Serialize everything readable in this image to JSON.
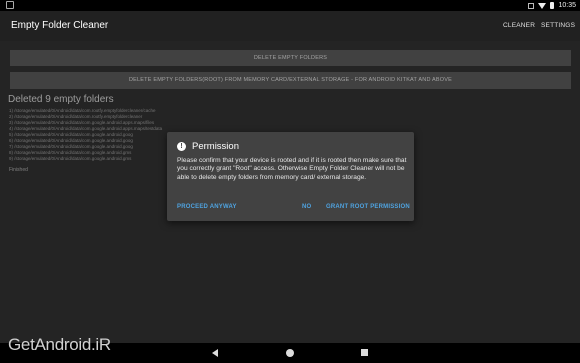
{
  "status_bar": {
    "time": "10:35"
  },
  "action_bar": {
    "title": "Empty Folder Cleaner",
    "menu": [
      "CLEANER",
      "SETTINGS"
    ]
  },
  "main": {
    "delete_button": "DELETE  EMPTY  FOLDERS",
    "delete_root_button": "DELETE EMPTY FOLDERS(ROOT) FROM MEMORY CARD/EXTERNAL STORAGE - FOR ANDROID KITKAT AND ABOVE",
    "deleted_title": "Deleted 9 empty folders",
    "folders": [
      "1) /storage/emulated/0/Android/data/com.rootfy.emptyfoldercleaner/cache",
      "2) /storage/emulated/0/Android/data/com.rootfy.emptyfoldercleaner",
      "3) /storage/emulated/0/Android/data/com.google.android.apps.maps/files",
      "4) /storage/emulated/0/Android/data/com.google.android.apps.maps/testdata",
      "5) /storage/emulated/0/Android/data/com.google.android.goog",
      "6) /storage/emulated/0/Android/data/com.google.android.goog",
      "7) /storage/emulated/0/Android/data/com.google.android.goog",
      "8) /storage/emulated/0/Android/data/com.google.android.gms",
      "9) /storage/emulated/0/Android/data/com.google.android.gms"
    ],
    "finished": "Finished"
  },
  "dialog": {
    "title": "Permission",
    "message": "Please confirm that your device is rooted and if it is rooted then make sure that you correctly grant \"Root\" access. Otherwise Empty Folder Cleaner will not be able to delete empty folders from memory card/ external storage.",
    "proceed": "PROCEED ANYWAY",
    "no": "NO",
    "grant": "GRANT ROOT PERMISSION"
  },
  "watermark": "GetAndroid.iR",
  "colors": {
    "accent": "#4fa3e0",
    "dialog_bg": "#424242",
    "action_bar": "#212121"
  },
  "icons": [
    "screenshot-icon",
    "wifi-icon",
    "battery-icon",
    "warning-icon",
    "back-icon",
    "home-icon",
    "recents-icon"
  ]
}
